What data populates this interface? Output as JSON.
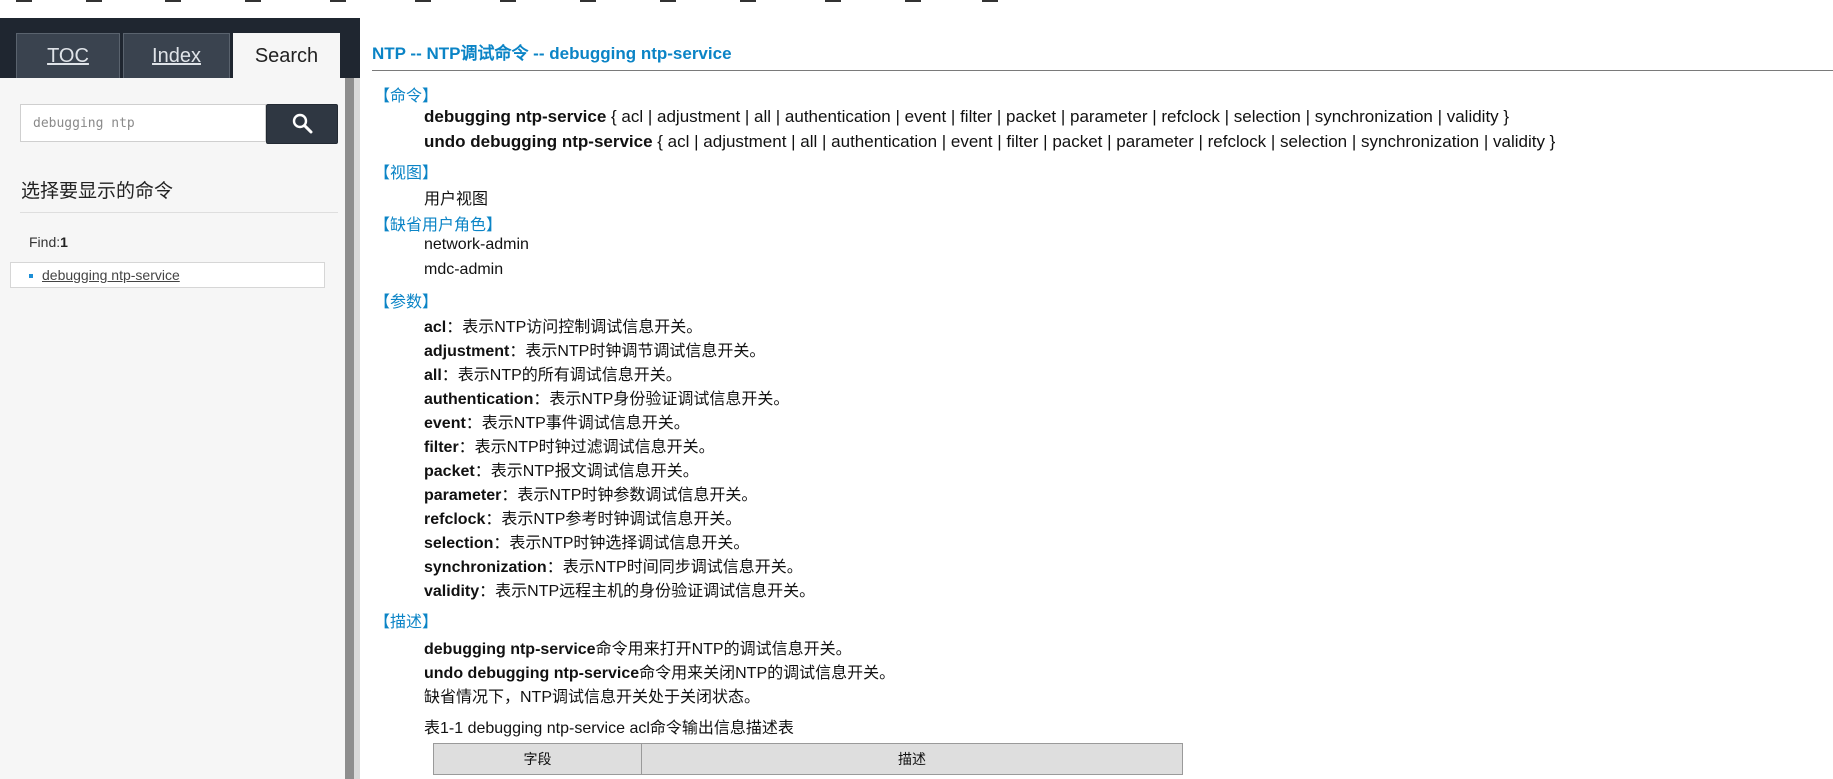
{
  "tabs": [
    {
      "label": "TOC"
    },
    {
      "label": "Index"
    },
    {
      "label": "Search"
    }
  ],
  "search": {
    "value": "debugging ntp",
    "button_icon": "search-icon"
  },
  "panel": {
    "heading": "选择要显示的命令",
    "find_label": "Find:",
    "find_count": "1",
    "results": [
      "debugging ntp-service"
    ]
  },
  "content": {
    "title": "NTP -- NTP调试命令 -- debugging ntp-service",
    "sections": {
      "command": "【命令】",
      "view": "【视图】",
      "role": "【缺省用户角色】",
      "params": "【参数】",
      "desc": "【描述】"
    },
    "command_lines": [
      {
        "cmd": "debugging ntp-service",
        "rest": " { acl | adjustment | all | authentication | event | filter | packet | parameter | refclock | selection | synchronization | validity }"
      },
      {
        "cmd": "undo debugging ntp-service",
        "rest": " { acl | adjustment | all | authentication | event | filter | packet | parameter | refclock | selection | synchronization | validity }"
      }
    ],
    "view": "用户视图",
    "roles": [
      "network-admin",
      "mdc-admin"
    ],
    "params": [
      {
        "name": "acl",
        "desc": "：表示NTP访问控制调试信息开关。"
      },
      {
        "name": "adjustment",
        "desc": "：表示NTP时钟调节调试信息开关。"
      },
      {
        "name": "all",
        "desc": "：表示NTP的所有调试信息开关。"
      },
      {
        "name": "authentication",
        "desc": "：表示NTP身份验证调试信息开关。"
      },
      {
        "name": "event",
        "desc": "：表示NTP事件调试信息开关。"
      },
      {
        "name": "filter",
        "desc": "：表示NTP时钟过滤调试信息开关。"
      },
      {
        "name": "packet",
        "desc": "：表示NTP报文调试信息开关。"
      },
      {
        "name": "parameter",
        "desc": "：表示NTP时钟参数调试信息开关。"
      },
      {
        "name": "refclock",
        "desc": "：表示NTP参考时钟调试信息开关。"
      },
      {
        "name": "selection",
        "desc": "：表示NTP时钟选择调试信息开关。"
      },
      {
        "name": "synchronization",
        "desc": "：表示NTP时间同步调试信息开关。"
      },
      {
        "name": "validity",
        "desc": "：表示NTP远程主机的身份验证调试信息开关。"
      }
    ],
    "desc_lines": [
      {
        "cmd": "debugging ntp-service",
        "text": "命令用来打开NTP的调试信息开关。"
      },
      {
        "cmd": "undo debugging ntp-service",
        "text": "命令用来关闭NTP的调试信息开关。"
      }
    ],
    "default_state": "缺省情况下，NTP调试信息开关处于关闭状态。",
    "table_caption": "表1-1 debugging ntp-service acl命令输出信息描述表",
    "table_headers": [
      "字段",
      "描述"
    ]
  },
  "colors": {
    "accent": "#0b84c6",
    "dark_bar": "#1f2630"
  }
}
